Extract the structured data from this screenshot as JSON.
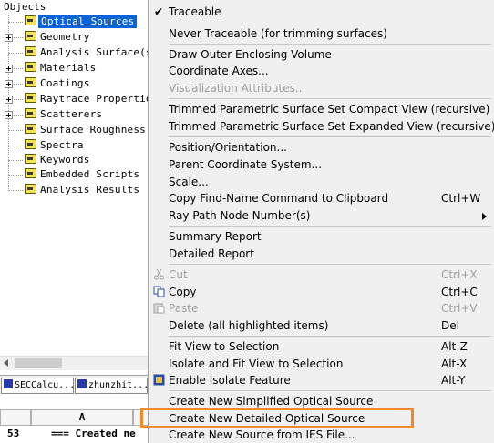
{
  "tree": {
    "title": "Objects",
    "nodes": [
      {
        "label": "Optical Sources",
        "selected": true,
        "expandable": false
      },
      {
        "label": "Geometry",
        "selected": false,
        "expandable": true
      },
      {
        "label": "Analysis Surface(s)",
        "selected": false,
        "expandable": false
      },
      {
        "label": "Materials",
        "selected": false,
        "expandable": true
      },
      {
        "label": "Coatings",
        "selected": false,
        "expandable": true
      },
      {
        "label": "Raytrace Properties",
        "selected": false,
        "expandable": true
      },
      {
        "label": "Scatterers",
        "selected": false,
        "expandable": true
      },
      {
        "label": "Surface Roughness",
        "selected": false,
        "expandable": false
      },
      {
        "label": "Spectra",
        "selected": false,
        "expandable": false
      },
      {
        "label": "Keywords",
        "selected": false,
        "expandable": false
      },
      {
        "label": "Embedded Scripts",
        "selected": false,
        "expandable": false
      },
      {
        "label": "Analysis Results",
        "selected": false,
        "expandable": false
      }
    ]
  },
  "window_tabs": [
    {
      "label": "SECCalcu..."
    },
    {
      "label": "zhunzhit..."
    }
  ],
  "grid": {
    "col_header": "A",
    "row_number": "53",
    "cell_text": "=== Created ne"
  },
  "menu": {
    "items": [
      {
        "label": "Traceable",
        "checked": true
      },
      {
        "label": "Never Traceable (for trimming surfaces)"
      },
      {
        "label": "Draw Outer Enclosing Volume"
      },
      {
        "label": "Coordinate Axes..."
      },
      {
        "label": "Visualization Attributes...",
        "disabled": true
      },
      {
        "label": "Trimmed Parametric Surface Set Compact View (recursive)"
      },
      {
        "label": "Trimmed Parametric Surface Set Expanded View (recursive)"
      },
      {
        "label": "Position/Orientation..."
      },
      {
        "label": "Parent Coordinate System..."
      },
      {
        "label": "Scale..."
      },
      {
        "label": "Copy Find-Name Command to Clipboard",
        "shortcut": "Ctrl+W"
      },
      {
        "label": "Ray Path Node Number(s)",
        "submenu": true
      },
      {
        "label": "Summary Report"
      },
      {
        "label": "Detailed Report"
      },
      {
        "label": "Cut",
        "shortcut": "Ctrl+X",
        "disabled": true,
        "icon": "scissors-icon"
      },
      {
        "label": "Copy",
        "shortcut": "Ctrl+C",
        "icon": "copy-icon"
      },
      {
        "label": "Paste",
        "shortcut": "Ctrl+V",
        "disabled": true,
        "icon": "paste-icon"
      },
      {
        "label": "Delete (all highlighted items)",
        "shortcut": "Del"
      },
      {
        "label": "Fit View to Selection",
        "shortcut": "Alt-Z"
      },
      {
        "label": "Isolate and Fit View to Selection",
        "shortcut": "Alt-X"
      },
      {
        "label": "Enable Isolate Feature",
        "shortcut": "Alt-Y",
        "icon": "isolate-icon"
      },
      {
        "label": "Create New Simplified Optical Source"
      },
      {
        "label": "Create New Detailed Optical Source",
        "highlighted": true
      },
      {
        "label": "Create New Source from IES File..."
      }
    ]
  },
  "colors": {
    "selection": "#0a64d8",
    "highlight_box": "#f08a24",
    "menu_bg": "#f0f0f0",
    "disabled_text": "#a0a0a0"
  }
}
